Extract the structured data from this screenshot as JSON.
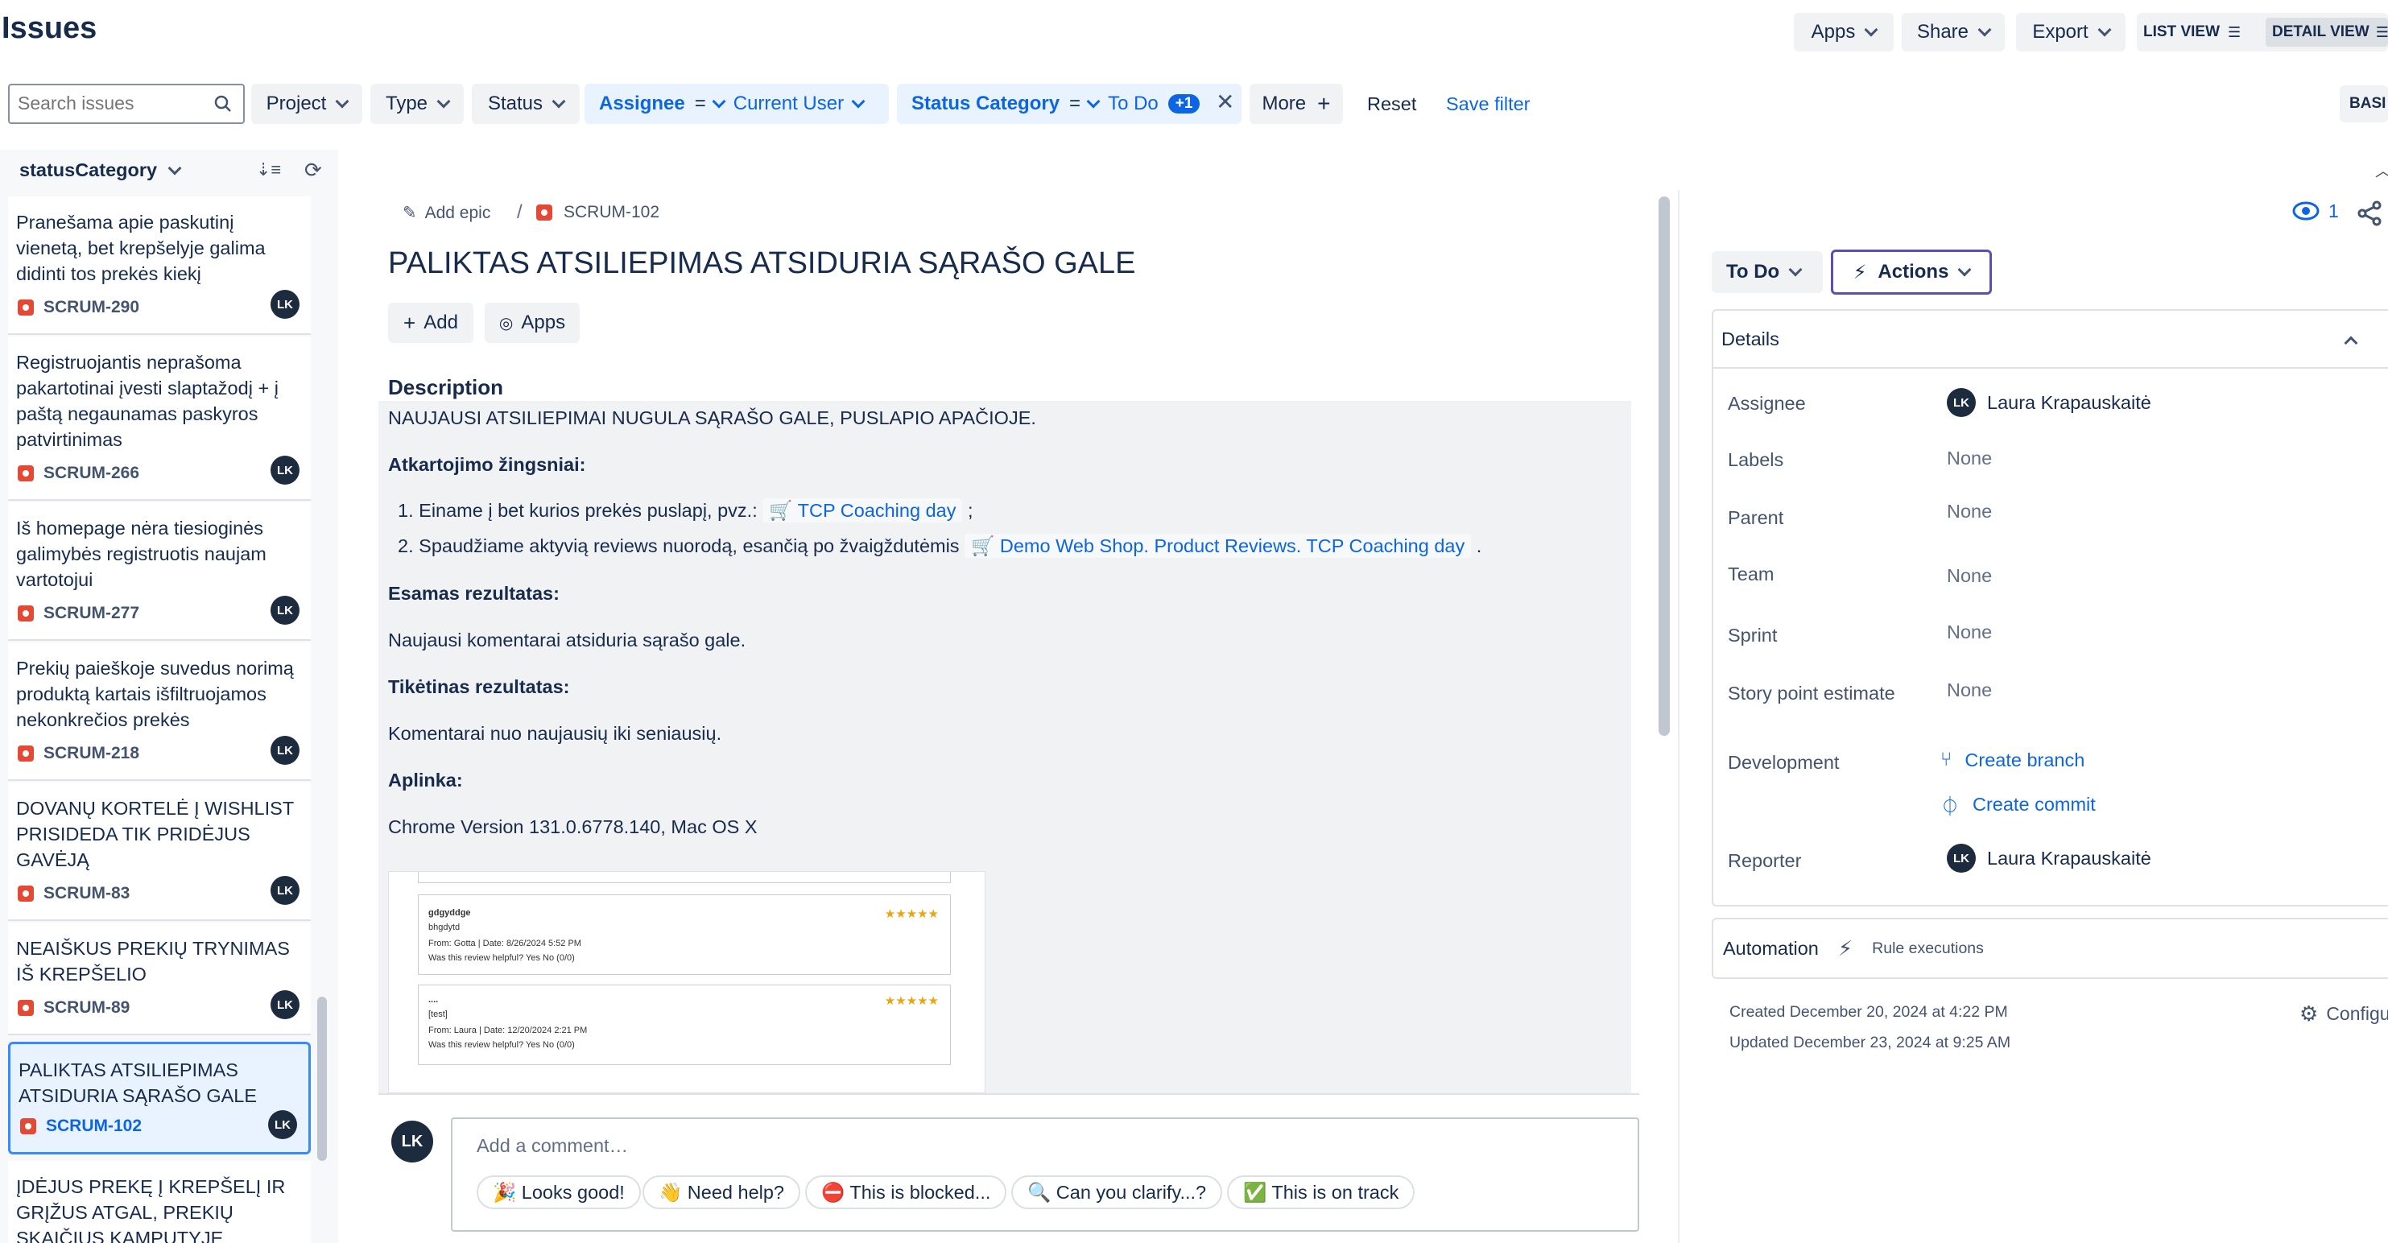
{
  "header": {
    "title": "Issues",
    "apps_label": "Apps",
    "share_label": "Share",
    "export_label": "Export",
    "list_view_label": "LIST VIEW",
    "detail_view_label": "DETAIL VIEW",
    "basic_label": "BASI"
  },
  "filters": {
    "search_placeholder": "Search issues",
    "project": "Project",
    "type": "Type",
    "status": "Status",
    "assignee_field": "Assignee",
    "assignee_op": "=",
    "assignee_value": "Current User",
    "status_category_field": "Status Category",
    "status_category_op": "=",
    "status_category_value": "To Do",
    "status_category_more": "+1",
    "more": "More",
    "reset": "Reset",
    "save_filter": "Save filter"
  },
  "sidebar": {
    "sort_field": "statusCategory",
    "items": [
      {
        "title": "Pranešama apie paskutinį vienetą, bet krepšelyje galima didinti tos prekės kiekį",
        "key": "SCRUM-290",
        "avatar": "LK"
      },
      {
        "title": "Registruojantis neprašoma pakartotinai įvesti slaptažodį + į paštą negaunamas paskyros patvirtinimas",
        "key": "SCRUM-266",
        "avatar": "LK"
      },
      {
        "title": "Iš homepage nėra tiesioginės galimybės registruotis naujam vartotojui",
        "key": "SCRUM-277",
        "avatar": "LK"
      },
      {
        "title": "Prekių paieškoje suvedus norimą produktą kartais išfiltruojamos nekonkrečios prekės",
        "key": "SCRUM-218",
        "avatar": "LK"
      },
      {
        "title": "DOVANŲ KORTELĖ Į WISHLIST PRISIDEDA TIK PRIDĖJUS GAVĖJĄ",
        "key": "SCRUM-83",
        "avatar": "LK"
      },
      {
        "title": "NEAIŠKUS PREKIŲ TRYNIMAS IŠ KREPŠELIO",
        "key": "SCRUM-89",
        "avatar": "LK"
      },
      {
        "title": "PALIKTAS ATSILIEPIMAS ATSIDURIA SĄRAŠO GALE",
        "key": "SCRUM-102",
        "avatar": "LK"
      },
      {
        "title": "ĮDĖJUS PREKĘ Į KREPŠELĮ IR GRĮŽUS ATGAL, PREKIŲ SKAIČIUS KAMPUTYJE",
        "key": "",
        "avatar": ""
      }
    ]
  },
  "issue": {
    "add_epic": "Add epic",
    "separator": "/",
    "key": "SCRUM-102",
    "title": "PALIKTAS ATSILIEPIMAS ATSIDURIA SĄRAŠO GALE",
    "add_label": "Add",
    "apps_label": "Apps",
    "description_heading": "Description",
    "desc_line1": "NAUJAUSI ATSILIEPIMAI NUGULA SĄRAŠO GALE, PUSLAPIO APAČIOJE.",
    "steps_heading": "Atkartojimo žingsniai:",
    "step1_text": "Einame į bet kurios prekės puslapį, pvz.:",
    "step1_link": "TCP Coaching day",
    "step1_tail": ";",
    "step2_text": "Spaudžiame aktyvią reviews nuorodą, esančią po žvaigždutėmis",
    "step2_link": "Demo Web Shop. Product Reviews. TCP Coaching day",
    "step2_tail": ".",
    "current_heading": "Esamas rezultatas:",
    "current_text": "Naujausi komentarai atsiduria sąrašo gale.",
    "expected_heading": "Tikėtinas rezultatas:",
    "expected_text": "Komentarai nuo naujausių iki seniausių.",
    "env_heading": "Aplinka:",
    "env_text": "Chrome Version 131.0.6778.140, Mac OS X",
    "screenshot": {
      "r1_user": "gdgyddge",
      "r1_text": "bhgdytd",
      "r1_meta": "From: Gotta | Date: 8/26/2024 5:52 PM",
      "r1_helpful": "Was this review helpful? Yes No (0/0)",
      "r2_user": "....",
      "r2_text": "[test]",
      "r2_meta": "From: Laura | Date: 12/20/2024 2:21 PM",
      "r2_helpful": "Was this review helpful? Yes No (0/0)",
      "stars": "★★★★★"
    }
  },
  "comment": {
    "avatar": "LK",
    "placeholder": "Add a comment…",
    "chips": [
      "🎉 Looks good!",
      "👋 Need help?",
      "⛔ This is blocked...",
      "🔍 Can you clarify...?",
      "✅ This is on track"
    ]
  },
  "details_panel": {
    "watch_count": "1",
    "status_button": "To Do",
    "actions_button": "Actions",
    "details_heading": "Details",
    "assignee_label": "Assignee",
    "assignee_value": "Laura Krapauskaitė",
    "assignee_avatar": "LK",
    "labels_label": "Labels",
    "labels_value": "None",
    "parent_label": "Parent",
    "parent_value": "None",
    "team_label": "Team",
    "team_value": "None",
    "sprint_label": "Sprint",
    "sprint_value": "None",
    "story_label": "Story point estimate",
    "story_value": "None",
    "development_label": "Development",
    "create_branch": "Create branch",
    "create_commit": "Create commit",
    "reporter_label": "Reporter",
    "reporter_value": "Laura Krapauskaitė",
    "reporter_avatar": "LK",
    "automation_label": "Automation",
    "rule_executions": "Rule executions",
    "created": "Created December 20, 2024 at 4:22 PM",
    "updated": "Updated December 23, 2024 at 9:25 AM",
    "configure": "Configu"
  }
}
